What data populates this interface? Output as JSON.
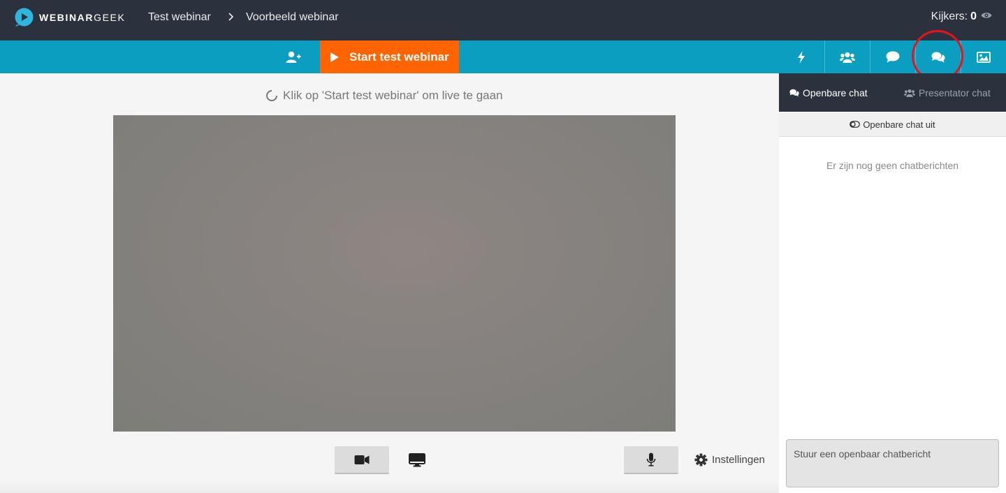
{
  "header": {
    "logo_bold": "WEBINAR",
    "logo_light": "GEEK",
    "breadcrumb": [
      "Test webinar",
      "Voorbeeld webinar"
    ],
    "viewers_label": "Kijkers:",
    "viewers_count": "0"
  },
  "toolbar": {
    "start_label": "Start test webinar",
    "tools": [
      "bolt-icon",
      "users-icon",
      "comment-icon",
      "comments-icon",
      "image-icon"
    ],
    "active_tool": "comments-icon",
    "highlight_color": "#e8121b"
  },
  "main": {
    "status_text": "Klik op 'Start test webinar' om live te gaan",
    "settings_label": "Instellingen"
  },
  "chat": {
    "tab_public": "Openbare chat",
    "tab_presenter": "Presentator chat",
    "toggle_label": "Openbare chat uit",
    "empty_text": "Er zijn nog geen chatberichten",
    "input_placeholder": "Stuur een openbaar chatbericht"
  },
  "colors": {
    "header_bg": "#2c323d",
    "toolbar_bg": "#0a9fc0",
    "start_button": "#ff6400"
  }
}
